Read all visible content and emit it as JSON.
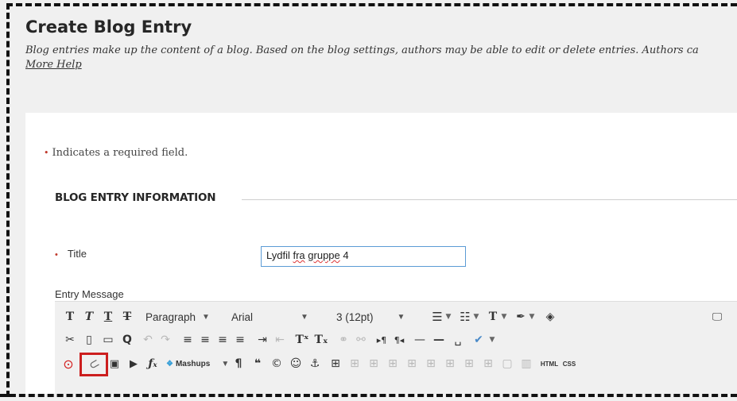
{
  "page": {
    "title": "Create Blog Entry",
    "description": "Blog entries make up the content of a blog. Based on the blog settings, authors may be able to edit or delete entries. Authors ca",
    "more_help": "More Help"
  },
  "form": {
    "required_note": "Indicates a required field.",
    "required_marker": "•",
    "section_title": "BLOG ENTRY INFORMATION",
    "title_label": "Title",
    "title_value_prefix": "Lydfil ",
    "title_value_word1": "fra",
    "title_value_mid": " ",
    "title_value_word2": "gruppe",
    "title_value_suffix": " 4",
    "entry_message_label": "Entry Message"
  },
  "toolbar": {
    "paragraph_label": "Paragraph",
    "font_label": "Arial",
    "size_label": "3 (12pt)",
    "mashups_label": "Mashups",
    "html_label": "HTML",
    "css_label": "CSS"
  },
  "colors": {
    "highlight": "#cc1e1e",
    "input_border": "#5b9bd5",
    "required": "#c0392b"
  }
}
